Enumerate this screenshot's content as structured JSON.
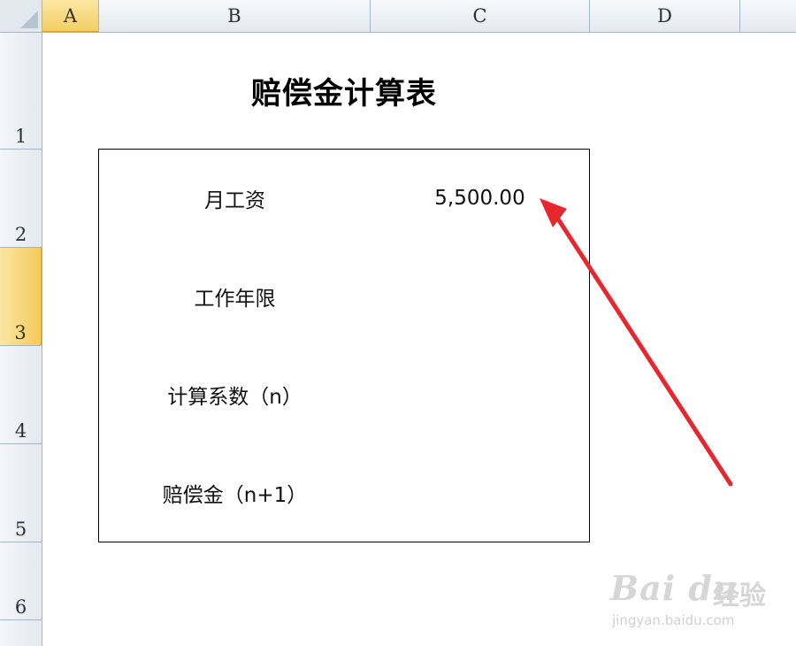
{
  "column_headers": [
    "A",
    "B",
    "C",
    "D"
  ],
  "row_headers": [
    "1",
    "2",
    "3",
    "4",
    "5",
    "6"
  ],
  "sheet": {
    "title": "赔偿金计算表",
    "rows": [
      {
        "label": "月工资",
        "value": "5,500.00"
      },
      {
        "label": "工作年限",
        "value": ""
      },
      {
        "label": "计算系数（n）",
        "value": ""
      },
      {
        "label": "赔偿金（n+1）",
        "value": ""
      }
    ]
  },
  "selection": {
    "column": "A",
    "row": "3"
  },
  "annotation": {
    "arrow_color": "#e8262d"
  },
  "watermark": {
    "logo": "Bai du",
    "brand_cn": "经验",
    "url": "jingyan.baidu.com"
  }
}
